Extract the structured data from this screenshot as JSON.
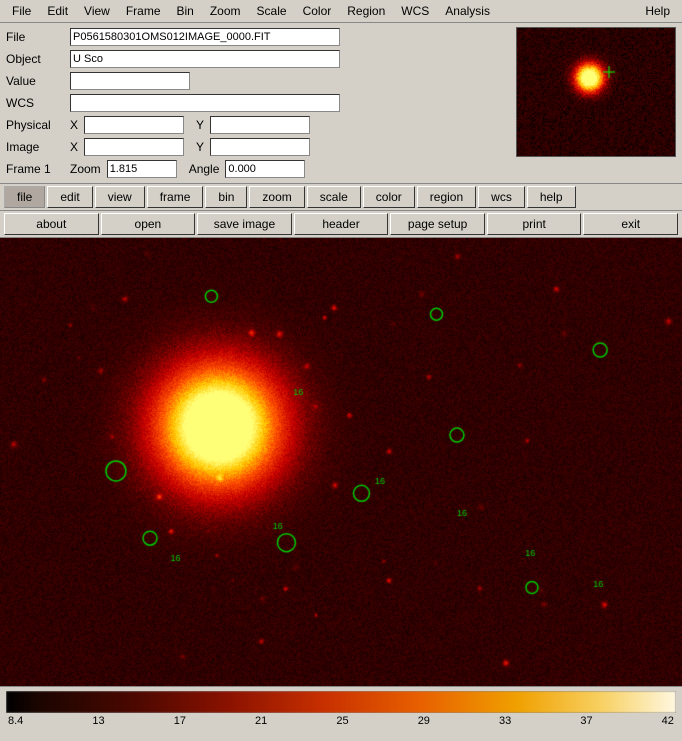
{
  "menubar": {
    "items": [
      "File",
      "Edit",
      "View",
      "Frame",
      "Bin",
      "Zoom",
      "Scale",
      "Color",
      "Region",
      "WCS",
      "Analysis",
      "Help"
    ]
  },
  "info": {
    "file_label": "File",
    "file_value": "P0561580301OMS012IMAGE_0000.FIT",
    "object_label": "Object",
    "object_value": "U Sco",
    "value_label": "Value",
    "wcs_label": "WCS",
    "physical_label": "Physical",
    "physical_x_label": "X",
    "physical_y_label": "Y",
    "image_label": "Image",
    "image_x_label": "X",
    "image_y_label": "Y",
    "frame_label": "Frame 1",
    "zoom_label": "Zoom",
    "zoom_value": "1.815",
    "angle_label": "Angle",
    "angle_value": "0.000"
  },
  "toolbar": {
    "items": [
      "file",
      "edit",
      "view",
      "frame",
      "bin",
      "zoom",
      "scale",
      "color",
      "region",
      "wcs",
      "help"
    ]
  },
  "actionbar": {
    "items": [
      "about",
      "open",
      "save image",
      "header",
      "page setup",
      "print",
      "exit"
    ]
  },
  "colorbar": {
    "labels": [
      "8.4",
      "13",
      "17",
      "21",
      "25",
      "29",
      "33",
      "37",
      "42"
    ]
  }
}
